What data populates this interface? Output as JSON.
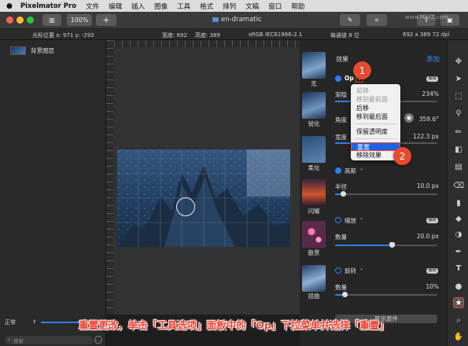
{
  "menubar": {
    "app_name": "Pixelmator Pro",
    "items": [
      "文件",
      "编辑",
      "插入",
      "图像",
      "工具",
      "格式",
      "排列",
      "文稿",
      "窗口",
      "帮助"
    ]
  },
  "titlebar": {
    "zoom": "100%",
    "doc_title": "en-dramatic",
    "add_label": "+",
    "watermark": "www.MacZ.com"
  },
  "infobar": {
    "cursor": "光标位置 x:  971     y:  -293",
    "width": "宽度:  692",
    "height": "高度:  389",
    "colorspace": "sRGB IEC61966-2.1",
    "depth": "每通道 8 位",
    "size": "692 x 389 72 dpi"
  },
  "layers": {
    "items": [
      {
        "name": "背景图层"
      }
    ],
    "blend_mode": "正常",
    "opacity": "100%",
    "search_placeholder": "搜索"
  },
  "effects": {
    "header": "效果",
    "add_label": "添加",
    "thumbnails": [
      {
        "label": "无"
      },
      {
        "label": "锐化"
      },
      {
        "label": "柔化"
      },
      {
        "label": "闪耀"
      },
      {
        "label": "散景"
      },
      {
        "label": "扭曲"
      }
    ],
    "op_label": "Op",
    "edit_label": "编辑",
    "fade_label": "渐隐",
    "fade_value": "234%",
    "angle_label": "角度",
    "angle_value": "359.6°",
    "width_label": "宽度",
    "width_value": "122.3 px",
    "gaussian_label": "高斯",
    "radius_label": "半径",
    "radius_value": "10.0 px",
    "zoom_label": "缩放",
    "zoom_amount_label": "数量",
    "zoom_amount_value": "20.0 px",
    "twirl_label": "旋转",
    "twirl_amount_label": "数量",
    "twirl_amount_value": "10%",
    "show_original": "显示原件"
  },
  "dropdown": {
    "items": [
      "前移",
      "移到最前面",
      "后移",
      "移到最后面",
      "保留透明度",
      "重置",
      "移除效果"
    ],
    "selected": "重置"
  },
  "annotations": {
    "step1": "1",
    "step2": "2"
  },
  "caption": "重置更改，单击「工具选项」面板中的「Op」下拉菜单并选择「重置」",
  "colors": {
    "accent": "#2f7df6",
    "badge": "#e64b2f",
    "caption": "#f03e2c"
  }
}
